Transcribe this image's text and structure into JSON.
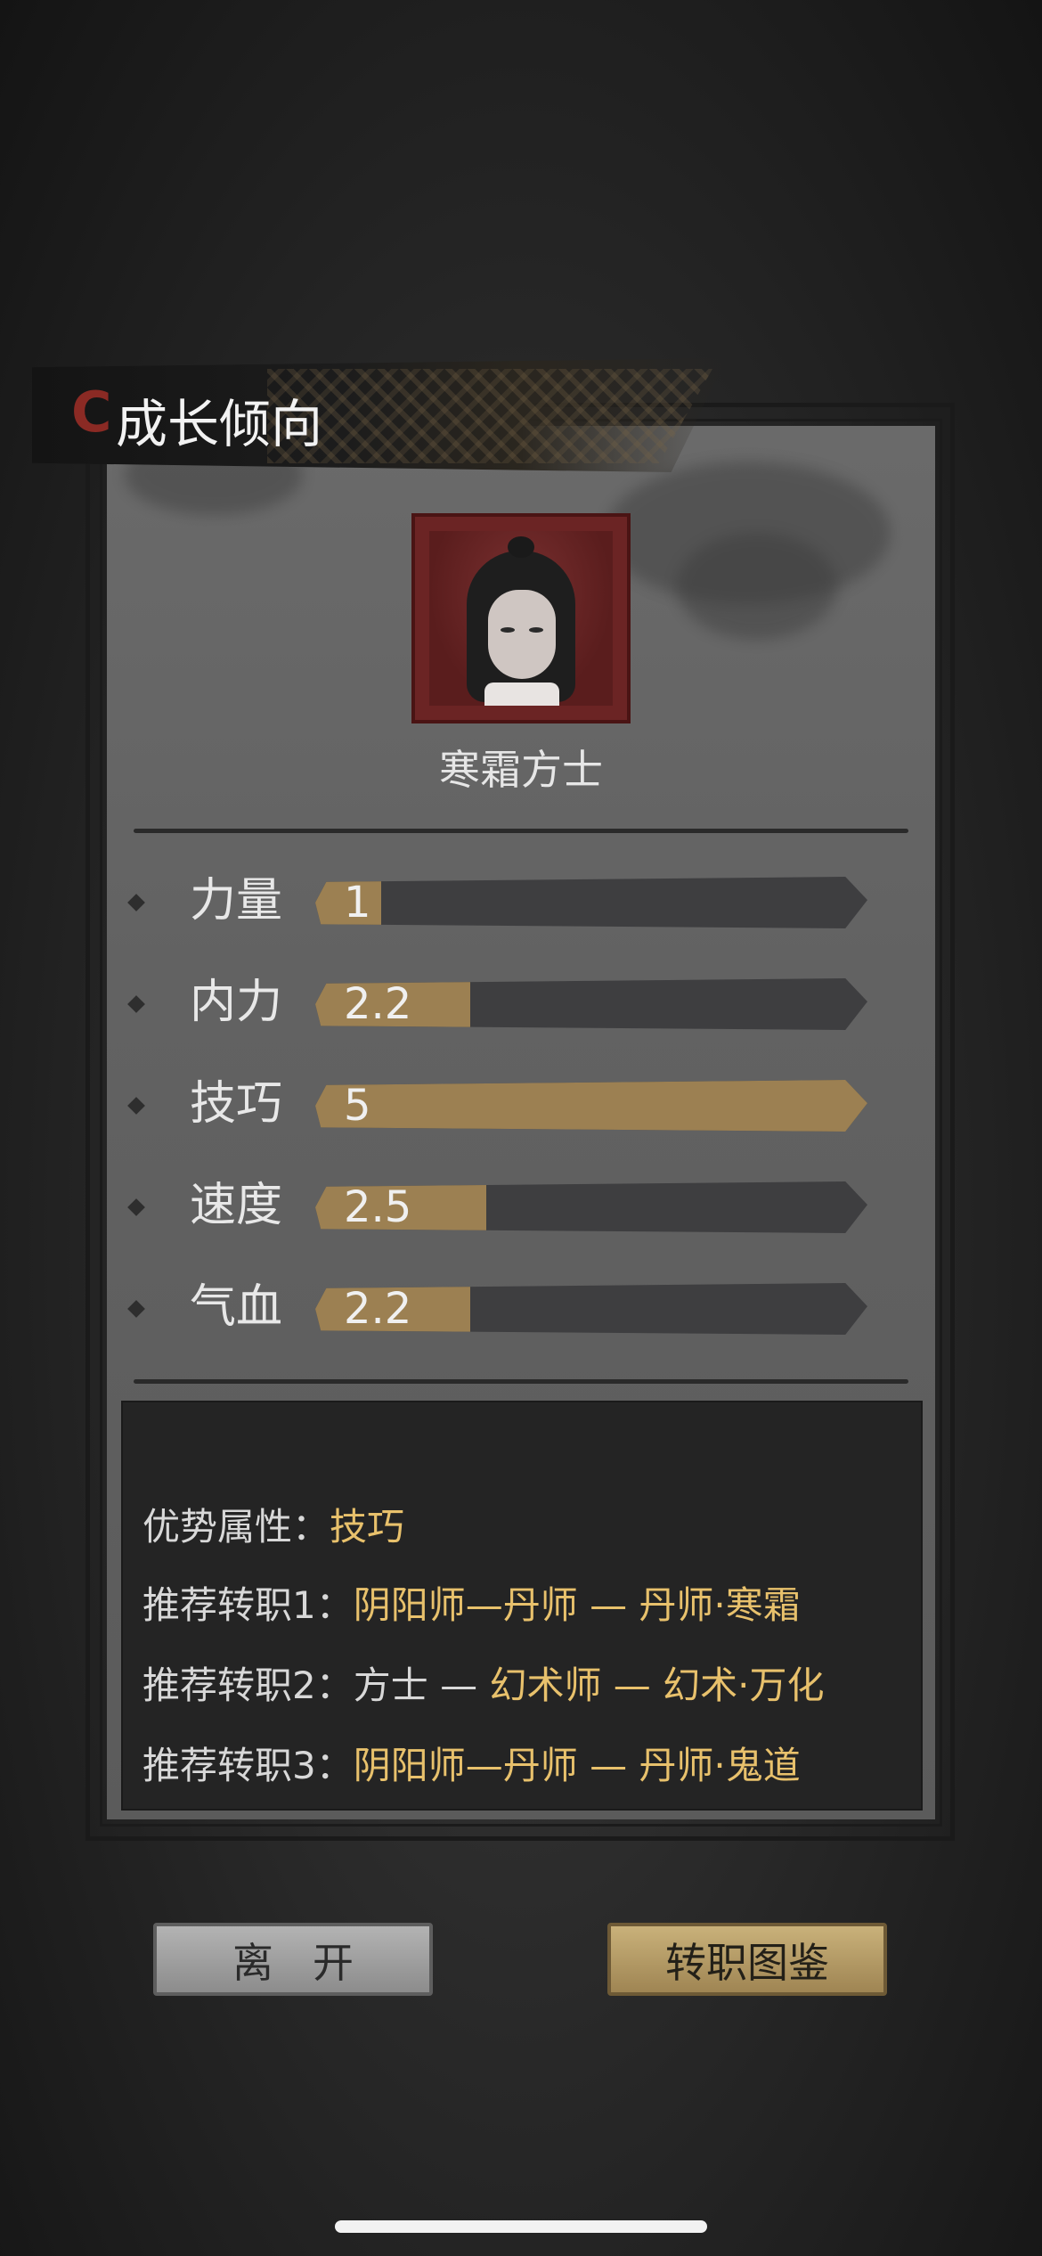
{
  "header": {
    "title": "成长倾向"
  },
  "character": {
    "name": "寒霜方士"
  },
  "stats": [
    {
      "label": "力量",
      "value": "1",
      "fill_fraction": 0.12
    },
    {
      "label": "内力",
      "value": "2.2",
      "fill_fraction": 0.28
    },
    {
      "label": "技巧",
      "value": "5",
      "fill_fraction": 1.0
    },
    {
      "label": "速度",
      "value": "2.5",
      "fill_fraction": 0.31
    },
    {
      "label": "气血",
      "value": "2.2",
      "fill_fraction": 0.28
    }
  ],
  "info": {
    "advantage_label": "优势属性：",
    "advantage_value": "技巧",
    "rec1_label": "推荐转职1：",
    "rec1_value": "阴阳师—丹师 — 丹师·寒霜",
    "rec2_label": "推荐转职2：",
    "rec2_plain": "方士 — ",
    "rec2_value": "幻术师 — 幻术·万化",
    "rec3_label": "推荐转职3：",
    "rec3_value": "阴阳师—丹师 — 丹师·鬼道"
  },
  "buttons": {
    "leave": "离开",
    "guide": "转职图鉴"
  },
  "colors": {
    "accent_gold": "#e8c16c",
    "bar_fill": "#9c8052",
    "bar_track": "#3e3e40",
    "title_icon": "#8b2a24"
  }
}
